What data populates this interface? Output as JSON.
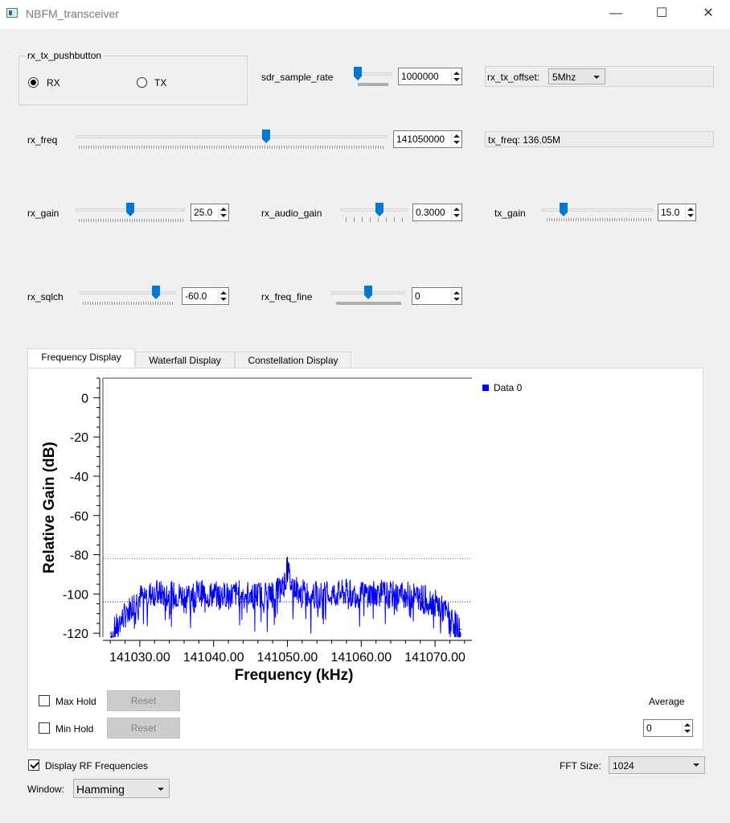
{
  "window": {
    "title": "NBFM_transceiver",
    "minimize": "—",
    "maximize": "☐",
    "close": "✕"
  },
  "rx_tx_group": {
    "title": "rx_tx_pushbutton",
    "rx_label": "RX",
    "tx_label": "TX",
    "selected": "RX"
  },
  "sdr_sample_rate": {
    "label": "sdr_sample_rate",
    "value": "1000000"
  },
  "rx_tx_offset": {
    "label": "rx_tx_offset:",
    "selected": "5Mhz"
  },
  "rx_freq": {
    "label": "rx_freq",
    "value": "141050000"
  },
  "tx_freq": {
    "text": "tx_freq: 136.05M"
  },
  "rx_gain": {
    "label": "rx_gain",
    "value": "25.0"
  },
  "rx_audio_gain": {
    "label": "rx_audio_gain",
    "value": "0.3000"
  },
  "tx_gain": {
    "label": "tx_gain",
    "value": "15.0"
  },
  "rx_sqlch": {
    "label": "rx_sqlch",
    "value": "-60.0"
  },
  "rx_freq_fine": {
    "label": "rx_freq_fine",
    "value": "0"
  },
  "tabs": [
    {
      "label": "Frequency Display",
      "active": true
    },
    {
      "label": "Waterfall Display",
      "active": false
    },
    {
      "label": "Constellation Display",
      "active": false
    }
  ],
  "chart_data": {
    "type": "line",
    "xlabel": "Frequency (kHz)",
    "ylabel": "Relative Gain (dB)",
    "xlim": [
      141025.0,
      141075.0
    ],
    "ylim": [
      -122,
      10
    ],
    "x_ticks": [
      "141030.00",
      "141040.00",
      "141050.00",
      "141060.00",
      "141070.00"
    ],
    "x_tick_values": [
      141030,
      141040,
      141050,
      141060,
      141070
    ],
    "y_ticks": [
      "0",
      "-20",
      "-40",
      "-60",
      "-80",
      "-100",
      "-120"
    ],
    "y_tick_values": [
      0,
      -20,
      -40,
      -60,
      -80,
      -100,
      -120
    ],
    "series": [
      {
        "name": "Data 0",
        "color": "#0000ff",
        "x": [
          141026.0,
          141027.5,
          141029.0,
          141030.0,
          141032.0,
          141034.0,
          141036.0,
          141038.0,
          141040.0,
          141042.0,
          141044.0,
          141046.0,
          141048.0,
          141049.5,
          141050.0,
          141050.5,
          141052.0,
          141054.0,
          141056.0,
          141058.0,
          141060.0,
          141062.0,
          141064.0,
          141066.0,
          141068.0,
          141070.0,
          141072.0,
          141073.5
        ],
        "y": [
          -120,
          -112,
          -104,
          -100,
          -98,
          -99,
          -99,
          -98,
          -99,
          -99,
          -98,
          -99,
          -98,
          -94,
          -85,
          -94,
          -98,
          -99,
          -99,
          -98,
          -99,
          -98,
          -99,
          -99,
          -100,
          -103,
          -110,
          -118
        ]
      }
    ],
    "legend": {
      "entries": [
        "Data 0"
      ],
      "placement": "top-right"
    },
    "markers": {
      "max_level_db": -82,
      "noise_level_db": -104
    }
  },
  "max_hold": {
    "label": "Max Hold",
    "checked": false,
    "reset": "Reset"
  },
  "min_hold": {
    "label": "Min Hold",
    "checked": false,
    "reset": "Reset"
  },
  "average": {
    "label": "Average",
    "value": "0"
  },
  "display_rf": {
    "label": "Display RF Frequencies",
    "checked": true
  },
  "fft_size": {
    "label": "FFT Size:",
    "selected": "1024"
  },
  "window_fn": {
    "label": "Window:",
    "selected": "Hamming"
  }
}
